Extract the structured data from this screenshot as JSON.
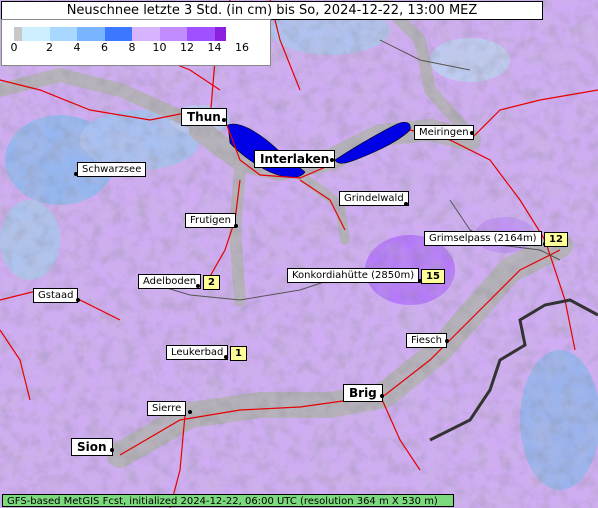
{
  "title": "Neuschnee letzte 3 Std. (in cm) bis So, 2024-12-22, 13:00 MEZ",
  "legend": {
    "ticks": [
      "0",
      "2",
      "4",
      "6",
      "8",
      "10",
      "12",
      "14",
      "16"
    ],
    "colors": [
      "#c8c8c8",
      "#cdeeff",
      "#a8d8ff",
      "#78b4ff",
      "#3c78ff",
      "#d8b4ff",
      "#c08cff",
      "#a050ff",
      "#8c1ee0"
    ]
  },
  "places": [
    {
      "name": "Thun",
      "size": "big"
    },
    {
      "name": "Interlaken",
      "size": "big"
    },
    {
      "name": "Meiringen",
      "size": "small"
    },
    {
      "name": "Schwarzsee",
      "size": "small"
    },
    {
      "name": "Grindelwald",
      "size": "small"
    },
    {
      "name": "Frutigen",
      "size": "small"
    },
    {
      "name": "Grimselpass (2164m)",
      "size": "small",
      "snow": "12"
    },
    {
      "name": "Konkordiahütte (2850m)",
      "size": "small",
      "snow": "15"
    },
    {
      "name": "Adelboden",
      "size": "small",
      "snow": "2"
    },
    {
      "name": "Gstaad",
      "size": "small"
    },
    {
      "name": "Fiesch",
      "size": "small"
    },
    {
      "name": "Leukerbad",
      "size": "small",
      "snow": "1"
    },
    {
      "name": "Brig",
      "size": "big"
    },
    {
      "name": "Sierre",
      "size": "small"
    },
    {
      "name": "Sion",
      "size": "big"
    }
  ],
  "footer": "GFS-based MetGIS Fcst, initialized 2024-12-22, 06:00 UTC  (resolution 364 m X 530 m)"
}
